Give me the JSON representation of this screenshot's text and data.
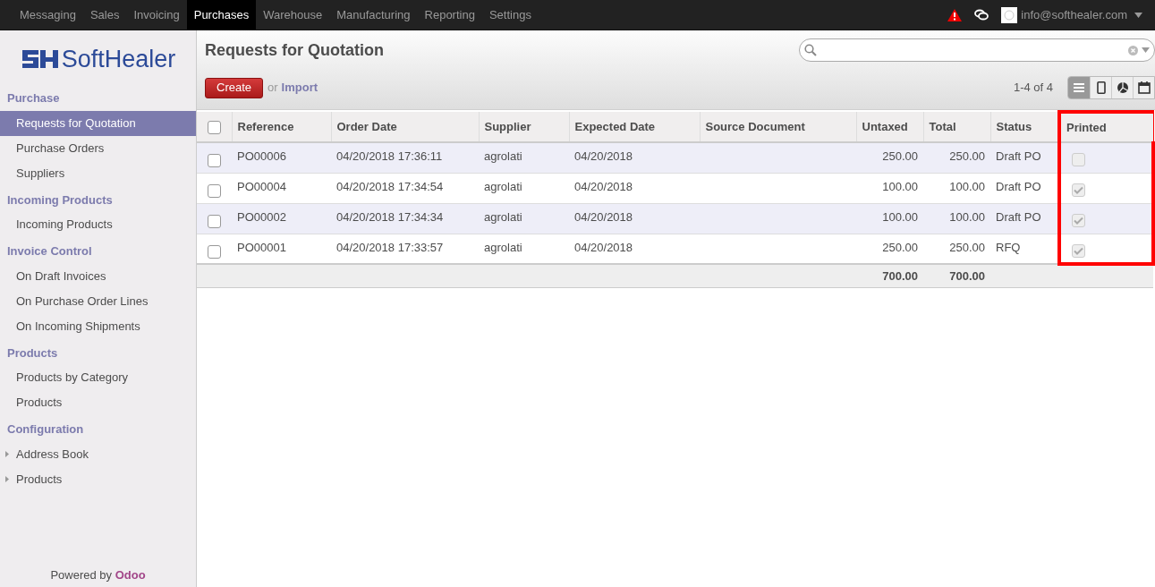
{
  "top_menu": [
    {
      "label": "Messaging",
      "selected": false
    },
    {
      "label": "Sales",
      "selected": false
    },
    {
      "label": "Invoicing",
      "selected": false
    },
    {
      "label": "Purchases",
      "selected": true
    },
    {
      "label": "Warehouse",
      "selected": false
    },
    {
      "label": "Manufacturing",
      "selected": false
    },
    {
      "label": "Reporting",
      "selected": false
    },
    {
      "label": "Settings",
      "selected": false
    }
  ],
  "user": {
    "email": "info@softhealer.com"
  },
  "logo": {
    "text": "SoftHealer"
  },
  "sidebar": {
    "sections": [
      {
        "title": "Purchase",
        "items": [
          {
            "label": "Requests for Quotation",
            "selected": true
          },
          {
            "label": "Purchase Orders",
            "selected": false
          },
          {
            "label": "Suppliers",
            "selected": false
          }
        ]
      },
      {
        "title": "Incoming Products",
        "items": [
          {
            "label": "Incoming Products",
            "selected": false
          }
        ]
      },
      {
        "title": "Invoice Control",
        "items": [
          {
            "label": "On Draft Invoices",
            "selected": false
          },
          {
            "label": "On Purchase Order Lines",
            "selected": false
          },
          {
            "label": "On Incoming Shipments",
            "selected": false
          }
        ]
      },
      {
        "title": "Products",
        "items": [
          {
            "label": "Products by Category",
            "selected": false
          },
          {
            "label": "Products",
            "selected": false
          }
        ]
      },
      {
        "title": "Configuration",
        "items": [
          {
            "label": "Address Book",
            "selected": false,
            "expanded": false
          },
          {
            "label": "Products",
            "selected": false,
            "expanded": false
          }
        ]
      }
    ],
    "footer": {
      "prefix": "Powered by",
      "brand": "Odoo"
    }
  },
  "page": {
    "title": "Requests for Quotation",
    "create_label": "Create",
    "or_text": "or",
    "import_label": "Import",
    "pager": "1-4 of 4",
    "views": [
      {
        "kind": "list",
        "selected": true
      },
      {
        "kind": "form",
        "selected": false
      },
      {
        "kind": "graph",
        "selected": false
      },
      {
        "kind": "calendar",
        "selected": false
      }
    ]
  },
  "table": {
    "columns": [
      {
        "label": "Reference",
        "highlighted": false
      },
      {
        "label": "Order Date",
        "highlighted": false
      },
      {
        "label": "Supplier",
        "highlighted": false
      },
      {
        "label": "Expected Date",
        "highlighted": false
      },
      {
        "label": "Source Document",
        "highlighted": false
      },
      {
        "label": "Untaxed",
        "highlighted": false
      },
      {
        "label": "Total",
        "highlighted": false
      },
      {
        "label": "Status",
        "highlighted": false
      },
      {
        "label": "Printed",
        "highlighted": true
      }
    ],
    "select_all": {
      "checked": false
    },
    "rows": [
      {
        "selected": false,
        "reference": "PO00006",
        "order_date": "04/20/2018 17:36:11",
        "supplier": "agrolati",
        "expected_date": "04/20/2018",
        "untaxed": "250.00",
        "total": "250.00",
        "status": "Draft PO",
        "printed": false
      },
      {
        "selected": false,
        "reference": "PO00004",
        "order_date": "04/20/2018 17:34:54",
        "supplier": "agrolati",
        "expected_date": "04/20/2018",
        "untaxed": "100.00",
        "total": "100.00",
        "status": "Draft PO",
        "printed": true
      },
      {
        "selected": false,
        "reference": "PO00002",
        "order_date": "04/20/2018 17:34:34",
        "supplier": "agrolati",
        "expected_date": "04/20/2018",
        "untaxed": "100.00",
        "total": "100.00",
        "status": "Draft PO",
        "printed": true
      },
      {
        "selected": false,
        "reference": "PO00001",
        "order_date": "04/20/2018 17:33:57",
        "supplier": "agrolati",
        "expected_date": "04/20/2018",
        "untaxed": "250.00",
        "total": "250.00",
        "status": "RFQ",
        "printed": true
      }
    ],
    "totals": {
      "untaxed": "700.00",
      "total": "700.00"
    }
  }
}
